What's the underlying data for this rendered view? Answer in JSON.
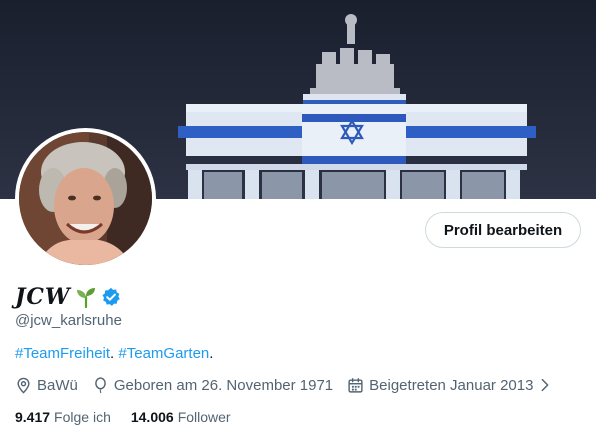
{
  "profile": {
    "display_name": "JCW",
    "handle": "@jcw_karlsruhe",
    "edit_button": "Profil bearbeiten",
    "bio": {
      "tag1": "#TeamFreiheit",
      "sep": ". ",
      "tag2": "#TeamGarten",
      "end": "."
    },
    "location": "BaWü",
    "birthday": "Geboren am 26. November 1971",
    "joined": "Beigetreten Januar 2013",
    "following_count": "9.417",
    "following_label": "Folge ich",
    "followers_count": "14.006",
    "followers_label": "Follower"
  },
  "icons": {
    "location": "location-pin-icon",
    "birthday": "balloon-icon",
    "joined": "calendar-icon",
    "verified": "verified-badge-icon",
    "emoji": "seedling-icon"
  },
  "colors": {
    "accent": "#1d9bf0",
    "secondary_text": "#536471",
    "primary_text": "#0f1419"
  }
}
